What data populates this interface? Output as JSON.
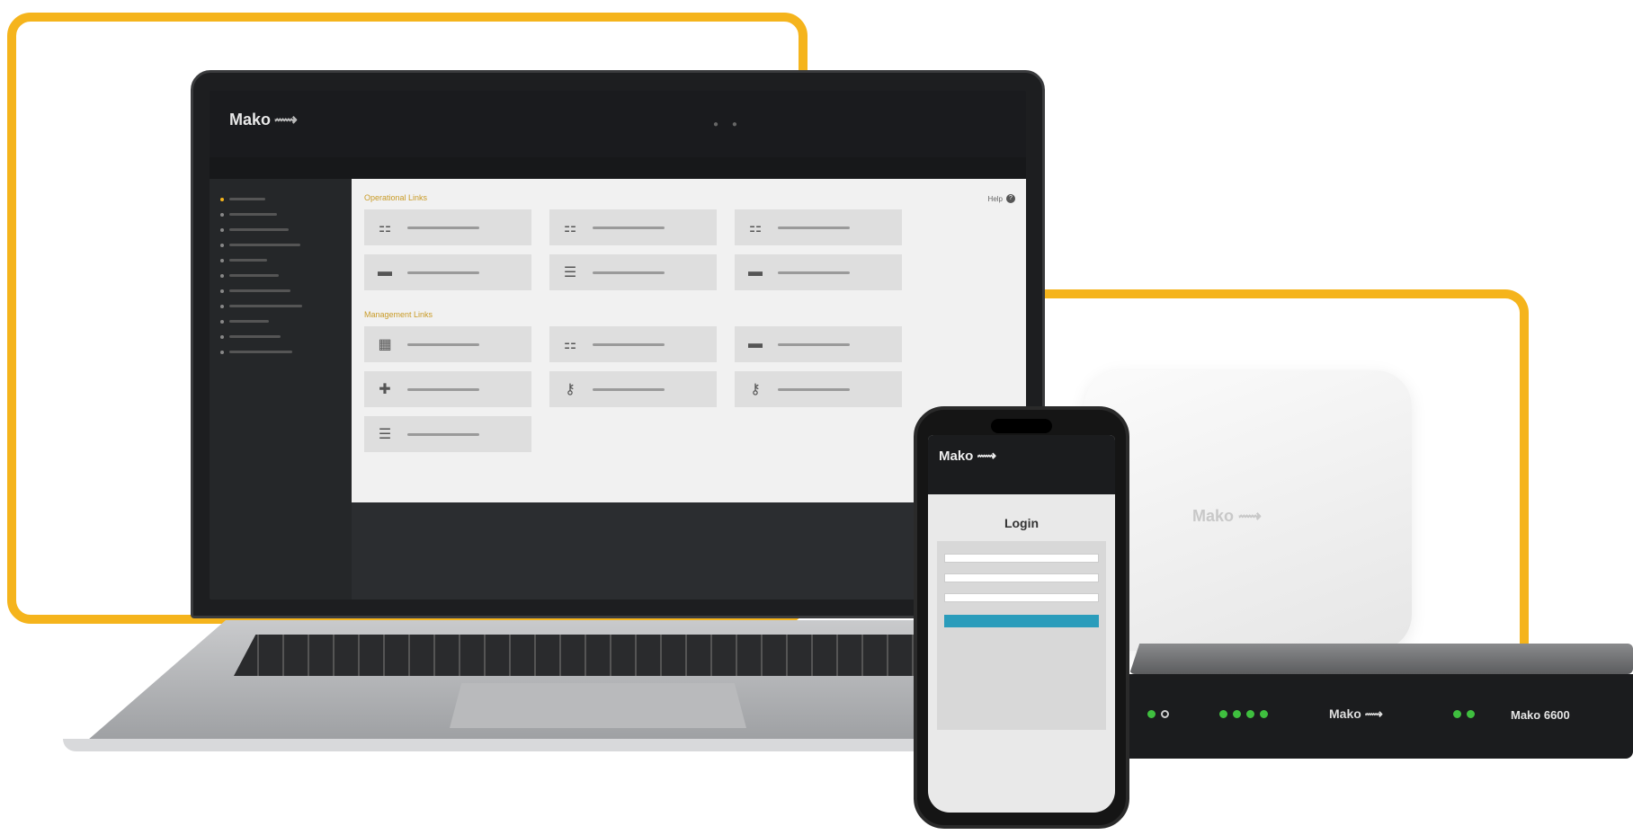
{
  "colors": {
    "accent": "#f5b41c",
    "login_button": "#2a9cbb",
    "link": "#2a7fa0"
  },
  "laptop_app": {
    "logo": "Mako",
    "sections": {
      "operations_title": "Operational Links",
      "management_title": "Management Links",
      "help_label": "Help"
    },
    "sidebar_items": [
      {
        "icon": "home-icon"
      },
      {
        "icon": "network-icon"
      },
      {
        "icon": "user-icon"
      },
      {
        "icon": "device-icon"
      },
      {
        "icon": "settings-icon"
      },
      {
        "icon": "chart-icon"
      },
      {
        "icon": "vpn-icon"
      },
      {
        "icon": "report-icon"
      },
      {
        "icon": "billing-icon"
      },
      {
        "icon": "support-icon"
      },
      {
        "icon": "logout-icon"
      }
    ],
    "operational_tiles": [
      {
        "icon": "org-chart-icon"
      },
      {
        "icon": "org-chart-icon"
      },
      {
        "icon": "org-chart-add-icon"
      },
      {
        "icon": "device-icon"
      },
      {
        "icon": "rack-icon"
      },
      {
        "icon": "device-add-icon"
      }
    ],
    "management_tiles": [
      {
        "icon": "building-icon"
      },
      {
        "icon": "org-chart-add-icon"
      },
      {
        "icon": "device-add-icon"
      },
      {
        "icon": "user-add-icon"
      },
      {
        "icon": "key-icon"
      },
      {
        "icon": "key-icon"
      },
      {
        "icon": "list-icon"
      }
    ]
  },
  "phone_app": {
    "logo": "Mako",
    "title": "Login",
    "fields": [
      {
        "icon": "text-field"
      },
      {
        "icon": "password-field"
      },
      {
        "icon": "text-field"
      }
    ]
  },
  "access_point": {
    "logo": "Mako"
  },
  "router": {
    "logo": "Mako",
    "model": "Mako 6600"
  }
}
